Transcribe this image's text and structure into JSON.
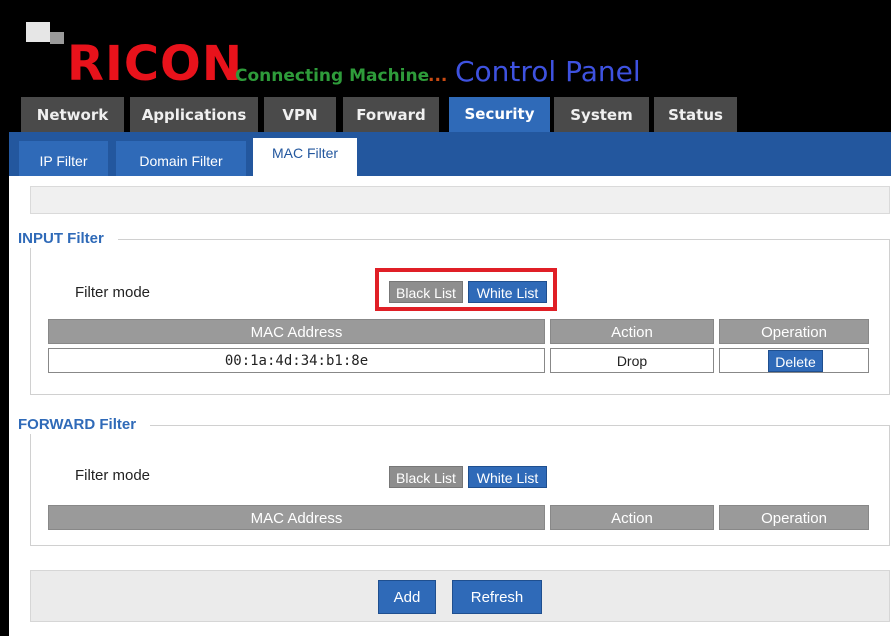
{
  "header": {
    "brand": "RICON",
    "tagline": "Connecting Machine",
    "tagline_suffix": "...",
    "title": "Control Panel"
  },
  "main_tabs": [
    {
      "label": "Network"
    },
    {
      "label": "Applications"
    },
    {
      "label": "VPN"
    },
    {
      "label": "Forward"
    },
    {
      "label": "Security",
      "active": true
    },
    {
      "label": "System"
    },
    {
      "label": "Status"
    }
  ],
  "sub_tabs": [
    {
      "label": "IP Filter"
    },
    {
      "label": "Domain Filter"
    },
    {
      "label": "MAC Filter",
      "active": true
    }
  ],
  "input_filter": {
    "legend": "INPUT Filter",
    "mode_label": "Filter mode",
    "black_list_label": "Black List",
    "white_list_label": "White List",
    "columns": [
      "MAC Address",
      "Action",
      "Operation"
    ],
    "rows": [
      {
        "mac": "00:1a:4d:34:b1:8e",
        "action": "Drop",
        "operation": "Delete"
      }
    ]
  },
  "forward_filter": {
    "legend": "FORWARD Filter",
    "mode_label": "Filter mode",
    "black_list_label": "Black List",
    "white_list_label": "White List",
    "columns": [
      "MAC Address",
      "Action",
      "Operation"
    ],
    "rows": []
  },
  "actions": {
    "add_label": "Add",
    "refresh_label": "Refresh"
  },
  "colors": {
    "brand_red": "#e8121b",
    "tagline_green": "#2e9b3a",
    "title_blue": "#3e52e0",
    "accent_blue": "#2f6ab8",
    "highlight_red": "#e01f26"
  }
}
